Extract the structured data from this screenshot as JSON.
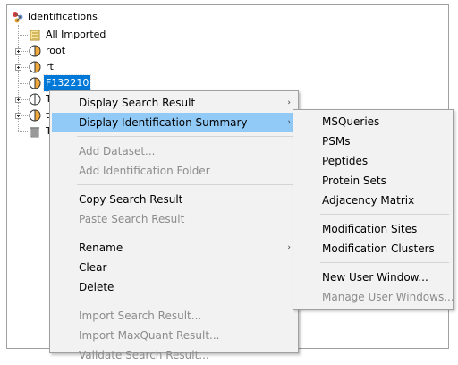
{
  "tree": {
    "root_label": "Identifications",
    "all_imported_label": "All Imported",
    "items": [
      {
        "label": "root"
      },
      {
        "label": "rt"
      },
      {
        "label": "F132210"
      },
      {
        "label": "T"
      },
      {
        "label": "t"
      },
      {
        "label": "T"
      }
    ]
  },
  "context_menu": {
    "items": [
      {
        "label": "Display Search Result"
      },
      {
        "label": "Display Identification Summary"
      },
      {
        "label": "Add Dataset..."
      },
      {
        "label": "Add Identification Folder"
      },
      {
        "label": "Copy Search Result"
      },
      {
        "label": "Paste Search Result"
      },
      {
        "label": "Rename"
      },
      {
        "label": "Clear"
      },
      {
        "label": "Delete"
      },
      {
        "label": "Import Search Result..."
      },
      {
        "label": "Import MaxQuant Result..."
      },
      {
        "label": "Validate Search Result..."
      }
    ],
    "submenu_arrow": "›"
  },
  "submenu": {
    "items": [
      {
        "label": "MSQueries"
      },
      {
        "label": "PSMs"
      },
      {
        "label": "Peptides"
      },
      {
        "label": "Protein Sets"
      },
      {
        "label": "Adjacency Matrix"
      },
      {
        "label": "Modification Sites"
      },
      {
        "label": "Modification Clusters"
      },
      {
        "label": "New User Window..."
      },
      {
        "label": "Manage User Windows..."
      }
    ]
  },
  "colors": {
    "selection": "#0078d7",
    "menu_highlight": "#91c9f7",
    "menu_background": "#f2f2f2",
    "disabled_text": "#8c8c8c"
  }
}
